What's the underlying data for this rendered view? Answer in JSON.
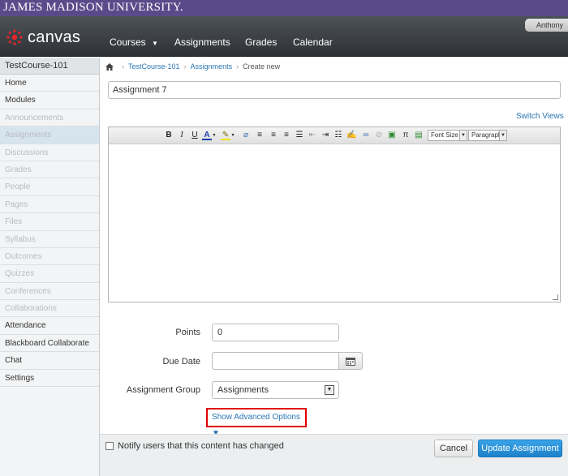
{
  "banner": {
    "title": "JAMES MADISON UNIVERSITY."
  },
  "header": {
    "logo_text": "canvas",
    "nav": [
      {
        "label": "Courses"
      },
      {
        "label": "Assignments"
      },
      {
        "label": "Grades"
      },
      {
        "label": "Calendar"
      }
    ],
    "user_name": "Anthony"
  },
  "sidebar": {
    "course_title": "TestCourse-101",
    "items": [
      {
        "label": "Home",
        "state": "enabled"
      },
      {
        "label": "Modules",
        "state": "enabled"
      },
      {
        "label": "Announcements",
        "state": "disabled"
      },
      {
        "label": "Assignments",
        "state": "active"
      },
      {
        "label": "Discussions",
        "state": "disabled"
      },
      {
        "label": "Grades",
        "state": "disabled"
      },
      {
        "label": "People",
        "state": "disabled"
      },
      {
        "label": "Pages",
        "state": "disabled"
      },
      {
        "label": "Files",
        "state": "disabled"
      },
      {
        "label": "Syllabus",
        "state": "disabled"
      },
      {
        "label": "Outcomes",
        "state": "disabled"
      },
      {
        "label": "Quizzes",
        "state": "disabled"
      },
      {
        "label": "Conferences",
        "state": "disabled"
      },
      {
        "label": "Collaborations",
        "state": "disabled"
      },
      {
        "label": "Attendance",
        "state": "enabled"
      },
      {
        "label": "Blackboard Collaborate",
        "state": "enabled"
      },
      {
        "label": "Chat",
        "state": "enabled"
      },
      {
        "label": "Settings",
        "state": "enabled"
      }
    ]
  },
  "breadcrumb": {
    "course": "TestCourse-101",
    "section": "Assignments",
    "current": "Create new"
  },
  "form": {
    "title_value": "Assignment 7",
    "switch_views": "Switch Views",
    "toolbar": {
      "font_size": "Font Size",
      "paragraph": "Paragraph"
    },
    "points_label": "Points",
    "points_value": "0",
    "due_date_label": "Due Date",
    "due_date_value": "",
    "group_label": "Assignment Group",
    "group_value": "Assignments",
    "advanced_options": "Show Advanced Options ▼"
  },
  "footer": {
    "notify_label": "Notify users that this content has changed",
    "cancel": "Cancel",
    "update": "Update Assignment"
  },
  "colors": {
    "jmu_purple": "#5b4a8a",
    "header_dark": "#3a3e42",
    "link_blue": "#2a75b3",
    "primary_blue": "#1d82c9",
    "highlight_red": "#e00000"
  }
}
